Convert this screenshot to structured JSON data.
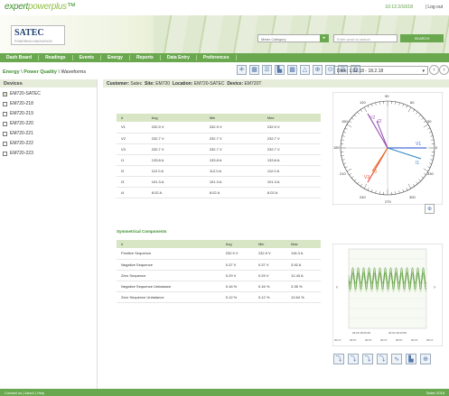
{
  "brand": {
    "logo_a": "expert",
    "logo_b": "powerplus",
    "trademark": "™",
    "company": "SATEC",
    "company_sub": "POWERING INNOVATION"
  },
  "topbar": {
    "time": "10:13 2/10/18",
    "separator": "|",
    "logout": "Log out"
  },
  "header": {
    "category_placeholder": "Meter Category",
    "search_placeholder": "Enter word to search",
    "search_button": "SEARCH"
  },
  "nav": {
    "items": [
      "Dash Board",
      "Readings",
      "Events",
      "Energy",
      "Reports",
      "Data Entry",
      "Preferences"
    ]
  },
  "breadcrumb": {
    "a": "Energy",
    "b": "Power Quality",
    "c": "Waveforms",
    "sep": "\\"
  },
  "date": {
    "value": "Date: 1.02.18 - 18.2.18"
  },
  "devices": {
    "title": "Devices",
    "items": [
      "EM720-SATEC",
      "EM720-218",
      "EM720-219",
      "EM720-220",
      "EM720-221",
      "EM720-222",
      "EM720-223"
    ]
  },
  "context": {
    "customer_label": "Customer:",
    "customer": "Satec",
    "site_label": "Site:",
    "site": "EM720",
    "location_label": "Location:",
    "location": "EM720-SATEC",
    "device_label": "Device:",
    "device": "EM720T"
  },
  "table1": {
    "headers": [
      "#",
      "Avg",
      "Min",
      "Max"
    ],
    "rows": [
      [
        "V1",
        "232.9 V",
        "232.9 V",
        "232.9 V"
      ],
      [
        "V2",
        "232.7 V",
        "232.7 V",
        "232.7 V"
      ],
      [
        "V3",
        "232.7 V",
        "232.7 V",
        "232.7 V"
      ],
      [
        "I1",
        "133.8 A",
        "133.8 A",
        "133.8 A"
      ],
      [
        "I2",
        "112.0 A",
        "112.0 A",
        "112.0 A"
      ],
      [
        "I3",
        "101.3 A",
        "101.3 A",
        "101.3 A"
      ],
      [
        "I4",
        "8.02 A",
        "8.02 A",
        "8.02 A"
      ]
    ]
  },
  "table2": {
    "title": "Symmetrical Components",
    "headers": [
      "#",
      "Avg",
      "Min",
      "Max"
    ],
    "rows": [
      [
        "Positive Sequence",
        "232.9 V",
        "232.9 V",
        "116.3 A"
      ],
      [
        "Negative Sequence",
        "0.37 V",
        "0.37 V",
        "3.92 A"
      ],
      [
        "Zero Sequence",
        "0.29 V",
        "0.29 V",
        "12.43 A"
      ],
      [
        "Negative Sequence Unbalance",
        "0.16 %",
        "0.16 %",
        "3.35 %"
      ],
      [
        "Zero Sequence Unbalance",
        "0.12 %",
        "0.12 %",
        "10.64 %"
      ]
    ]
  },
  "phasor": {
    "dial": [
      "90",
      "120",
      "150",
      "180",
      "210",
      "240",
      "270",
      "300",
      "330",
      "60",
      "30",
      "0"
    ],
    "phasors": [
      "V1",
      "V2",
      "V3",
      "I1",
      "I2",
      "I3"
    ]
  },
  "waveform": {
    "dates": [
      "26.02.18 00:00",
      "26.02.18 23:59"
    ],
    "xticks": [
      "00:17",
      "00:57",
      "00:37",
      "00:17",
      "00:57",
      "00:37",
      "00:17"
    ],
    "yticks": [
      "",
      "",
      "",
      "",
      "",
      "",
      "",
      ""
    ]
  },
  "footer": {
    "left": "Contact us  |  About  |  Help",
    "right": "Satec 2018"
  }
}
